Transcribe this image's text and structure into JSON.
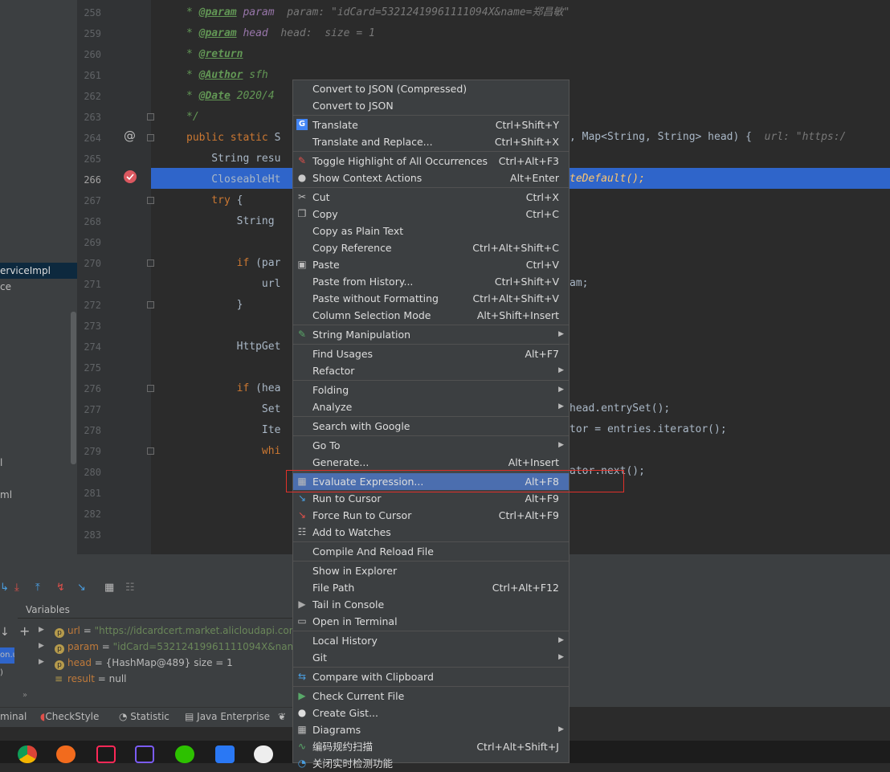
{
  "project_tree": {
    "items": [
      "erviceImpl",
      "ce",
      "l",
      "ml"
    ]
  },
  "editor": {
    "lines": [
      {
        "n": "258",
        "code": [
          [
            "cmt",
            "* "
          ],
          [
            "tag",
            "@param"
          ],
          [
            "plain",
            " "
          ],
          [
            "fld",
            "param"
          ],
          [
            "hint",
            "  param: \"idCard=53212419961111094X&name=郑昌敏\""
          ]
        ]
      },
      {
        "n": "259",
        "code": [
          [
            "cmt",
            "* "
          ],
          [
            "tag",
            "@param"
          ],
          [
            "plain",
            " "
          ],
          [
            "fld",
            "head"
          ],
          [
            "hint",
            "  head:  size = 1"
          ]
        ]
      },
      {
        "n": "260",
        "code": [
          [
            "cmt",
            "* "
          ],
          [
            "tag",
            "@return"
          ]
        ]
      },
      {
        "n": "261",
        "code": [
          [
            "cmt",
            "* "
          ],
          [
            "tag",
            "@Author"
          ],
          [
            "cmt",
            " sfh"
          ]
        ]
      },
      {
        "n": "262",
        "code": [
          [
            "cmt",
            "* "
          ],
          [
            "tag",
            "@Date"
          ],
          [
            "cmt",
            " 2020/4"
          ]
        ]
      },
      {
        "n": "263",
        "code": [
          [
            "cmt",
            "*/"
          ]
        ]
      },
      {
        "n": "264",
        "code": [
          [
            "kw",
            "public static "
          ],
          [
            "plain",
            "S"
          ]
        ]
      },
      {
        "n": "265",
        "code": [
          [
            "plain",
            "    String resu"
          ]
        ]
      },
      {
        "n": "266",
        "code": [
          [
            "plain",
            "    CloseableHt"
          ]
        ]
      },
      {
        "n": "267",
        "code": [
          [
            "kw",
            "    try "
          ],
          [
            "plain",
            "{"
          ]
        ]
      },
      {
        "n": "268",
        "code": [
          [
            "plain",
            "        String "
          ]
        ]
      },
      {
        "n": "269",
        "code": []
      },
      {
        "n": "270",
        "code": [
          [
            "kw",
            "        if "
          ],
          [
            "plain",
            "(par"
          ]
        ]
      },
      {
        "n": "271",
        "code": [
          [
            "plain",
            "            url"
          ]
        ]
      },
      {
        "n": "272",
        "code": [
          [
            "plain",
            "        }"
          ]
        ]
      },
      {
        "n": "273",
        "code": []
      },
      {
        "n": "274",
        "code": [
          [
            "plain",
            "        HttpGet"
          ]
        ]
      },
      {
        "n": "275",
        "code": []
      },
      {
        "n": "276",
        "code": [
          [
            "kw",
            "        if "
          ],
          [
            "plain",
            "(hea"
          ]
        ]
      },
      {
        "n": "277",
        "code": [
          [
            "plain",
            "            Set"
          ]
        ]
      },
      {
        "n": "278",
        "code": [
          [
            "plain",
            "            Ite"
          ]
        ]
      },
      {
        "n": "279",
        "code": [
          [
            "kw",
            "            whi"
          ]
        ]
      },
      {
        "n": "280",
        "code": []
      },
      {
        "n": "281",
        "code": []
      },
      {
        "n": "282",
        "code": []
      },
      {
        "n": "283",
        "code": []
      }
    ],
    "current_line": "266",
    "right_fragments": {
      "l264": ", Map<String, String> head) {",
      "l264_hint": "  url: \"https:/",
      "l266": "teDefault();",
      "l271": "am;",
      "l277": "head.entrySet();",
      "l278": "tor = entries.iterator();",
      "l280": "ator.next();"
    }
  },
  "debug": {
    "variables_title": "Variables",
    "variables": [
      {
        "name": "url",
        "value": "\"https://idcardcert.market.alicloudapi.com/",
        "badge": "p",
        "expandable": true
      },
      {
        "name": "param",
        "value": "\"idCard=53212419961111094X&name=",
        "badge": "p",
        "expandable": true
      },
      {
        "name": "head",
        "value": "{HashMap@489}  size = 1",
        "badge": "p",
        "expandable": true
      },
      {
        "name": "result",
        "value": "null",
        "badge": "",
        "expandable": false
      }
    ],
    "left_truncated": [
      "on.u",
      ")"
    ]
  },
  "bottom_tabs": [
    "minal",
    "CheckStyle",
    "Statistic",
    "Java Enterprise"
  ],
  "context_menu": {
    "items": [
      {
        "label": "Convert to JSON (Compressed)",
        "shortcut": "",
        "icon": "",
        "submenu": false,
        "sep_after": false
      },
      {
        "label": "Convert to JSON",
        "shortcut": "",
        "icon": "",
        "submenu": false,
        "sep_after": true
      },
      {
        "label": "Translate",
        "shortcut": "Ctrl+Shift+Y",
        "icon": "translate-icon",
        "submenu": false,
        "sep_after": false
      },
      {
        "label": "Translate and Replace...",
        "shortcut": "Ctrl+Shift+X",
        "icon": "",
        "submenu": false,
        "sep_after": true
      },
      {
        "label": "Toggle Highlight of All Occurrences",
        "shortcut": "Ctrl+Alt+F3",
        "icon": "highlighter-icon",
        "submenu": false,
        "sep_after": false
      },
      {
        "label": "Show Context Actions",
        "shortcut": "Alt+Enter",
        "icon": "lightbulb-icon",
        "submenu": false,
        "sep_after": true
      },
      {
        "label": "Cut",
        "shortcut": "Ctrl+X",
        "icon": "scissors-icon",
        "submenu": false,
        "sep_after": false
      },
      {
        "label": "Copy",
        "shortcut": "Ctrl+C",
        "icon": "copy-icon",
        "submenu": false,
        "sep_after": false
      },
      {
        "label": "Copy as Plain Text",
        "shortcut": "",
        "icon": "",
        "submenu": false,
        "sep_after": false
      },
      {
        "label": "Copy Reference",
        "shortcut": "Ctrl+Alt+Shift+C",
        "icon": "",
        "submenu": false,
        "sep_after": false
      },
      {
        "label": "Paste",
        "shortcut": "Ctrl+V",
        "icon": "clipboard-icon",
        "submenu": false,
        "sep_after": false
      },
      {
        "label": "Paste from History...",
        "shortcut": "Ctrl+Shift+V",
        "icon": "",
        "submenu": false,
        "sep_after": false
      },
      {
        "label": "Paste without Formatting",
        "shortcut": "Ctrl+Alt+Shift+V",
        "icon": "",
        "submenu": false,
        "sep_after": false
      },
      {
        "label": "Column Selection Mode",
        "shortcut": "Alt+Shift+Insert",
        "icon": "",
        "submenu": false,
        "sep_after": true
      },
      {
        "label": "String Manipulation",
        "shortcut": "",
        "icon": "pencil-icon",
        "submenu": true,
        "sep_after": true
      },
      {
        "label": "Find Usages",
        "shortcut": "Alt+F7",
        "icon": "",
        "submenu": false,
        "sep_after": false
      },
      {
        "label": "Refactor",
        "shortcut": "",
        "icon": "",
        "submenu": true,
        "sep_after": true
      },
      {
        "label": "Folding",
        "shortcut": "",
        "icon": "",
        "submenu": true,
        "sep_after": false
      },
      {
        "label": "Analyze",
        "shortcut": "",
        "icon": "",
        "submenu": true,
        "sep_after": true
      },
      {
        "label": "Search with Google",
        "shortcut": "",
        "icon": "",
        "submenu": false,
        "sep_after": true
      },
      {
        "label": "Go To",
        "shortcut": "",
        "icon": "",
        "submenu": true,
        "sep_after": false
      },
      {
        "label": "Generate...",
        "shortcut": "Alt+Insert",
        "icon": "",
        "submenu": false,
        "sep_after": true
      },
      {
        "label": "Evaluate Expression...",
        "shortcut": "Alt+F8",
        "icon": "calculator-icon",
        "submenu": false,
        "sep_after": false,
        "active": true
      },
      {
        "label": "Run to Cursor",
        "shortcut": "Alt+F9",
        "icon": "run-to-cursor-icon",
        "submenu": false,
        "sep_after": false
      },
      {
        "label": "Force Run to Cursor",
        "shortcut": "Ctrl+Alt+F9",
        "icon": "force-run-to-cursor-icon",
        "submenu": false,
        "sep_after": false
      },
      {
        "label": "Add to Watches",
        "shortcut": "",
        "icon": "watches-icon",
        "submenu": false,
        "sep_after": true
      },
      {
        "label": "Compile And Reload File",
        "shortcut": "",
        "icon": "",
        "submenu": false,
        "sep_after": true
      },
      {
        "label": "Show in Explorer",
        "shortcut": "",
        "icon": "",
        "submenu": false,
        "sep_after": false
      },
      {
        "label": "File Path",
        "shortcut": "Ctrl+Alt+F12",
        "icon": "",
        "submenu": false,
        "sep_after": false
      },
      {
        "label": "Tail in Console",
        "shortcut": "",
        "icon": "play-icon",
        "submenu": false,
        "sep_after": false
      },
      {
        "label": "Open in Terminal",
        "shortcut": "",
        "icon": "terminal-icon",
        "submenu": false,
        "sep_after": true
      },
      {
        "label": "Local History",
        "shortcut": "",
        "icon": "",
        "submenu": true,
        "sep_after": false
      },
      {
        "label": "Git",
        "shortcut": "",
        "icon": "",
        "submenu": true,
        "sep_after": true
      },
      {
        "label": "Compare with Clipboard",
        "shortcut": "",
        "icon": "compare-icon",
        "submenu": false,
        "sep_after": true
      },
      {
        "label": "Check Current File",
        "shortcut": "",
        "icon": "check-play-icon",
        "submenu": false,
        "sep_after": false
      },
      {
        "label": "Create Gist...",
        "shortcut": "",
        "icon": "github-icon",
        "submenu": false,
        "sep_after": false
      },
      {
        "label": "Diagrams",
        "shortcut": "",
        "icon": "diagram-icon",
        "submenu": true,
        "sep_after": false
      },
      {
        "label": "编码规约扫描",
        "shortcut": "Ctrl+Alt+Shift+J",
        "icon": "scan-icon",
        "submenu": false,
        "sep_after": false
      },
      {
        "label": "关闭实时检测功能",
        "shortcut": "",
        "icon": "realtime-icon",
        "submenu": false,
        "sep_after": false
      }
    ]
  },
  "colors": {
    "accent": "#4b6eaf",
    "highlight_line": "#2f65ca",
    "callout": "#e0312a"
  }
}
